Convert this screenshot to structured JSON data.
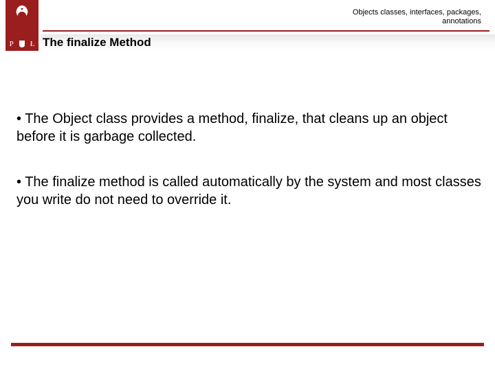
{
  "header": {
    "breadcrumb_line1": "Objects classes, interfaces, packages,",
    "breadcrumb_line2": "annotations",
    "title": "The finalize Method",
    "logo_letter_left": "P",
    "logo_letter_right": "Ł"
  },
  "bullets": [
    "• The Object class provides a method, finalize, that cleans up an object before it is garbage collected.",
    "• The finalize method is called automatically by the system and most classes you write do not need to override it."
  ]
}
